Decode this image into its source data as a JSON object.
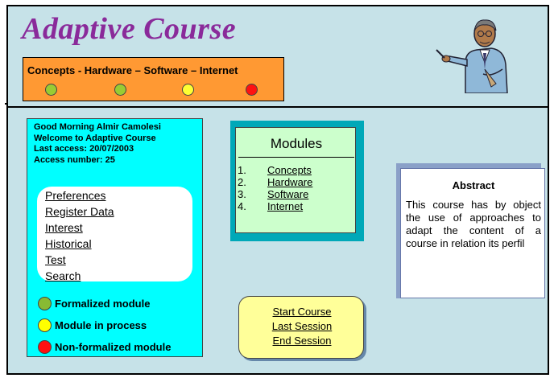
{
  "app": {
    "title": "Adaptive Course"
  },
  "topics": {
    "label": "Concepts  - Hardware – Software – Internet",
    "dots": [
      {
        "name": "Concepts",
        "color": "#99cc33"
      },
      {
        "name": "Hardware",
        "color": "#99cc33"
      },
      {
        "name": "Software",
        "color": "#ffff33"
      },
      {
        "name": "Internet",
        "color": "#ff1111"
      }
    ]
  },
  "user": {
    "greeting_prefix": "Good Morning ",
    "name": "Almir Camolesi",
    "welcome": "Welcome to Adaptive Course",
    "last_access": "Last access: 20/07/2003",
    "access_number": "Access number: 25"
  },
  "menu": {
    "items": [
      "Preferences",
      "Register Data",
      "Interest",
      "Historical",
      "Test",
      "Search"
    ]
  },
  "legend": {
    "items": [
      {
        "label": "Formalized module",
        "color": "#88bb33"
      },
      {
        "label": "Module in process",
        "color": "#ffff00"
      },
      {
        "label": "Non-formalized module",
        "color": "#ff1111"
      }
    ]
  },
  "modules": {
    "title": "Modules",
    "items": [
      {
        "num": "1.",
        "label": "Concepts"
      },
      {
        "num": "2.",
        "label": "Hardware"
      },
      {
        "num": "3.",
        "label": "Software"
      },
      {
        "num": "4.",
        "label": "Internet"
      }
    ]
  },
  "abstract": {
    "title": "Abstract",
    "text": "This course has by object the use of approaches to adapt the content of a course in relation its perfil"
  },
  "session": {
    "items": [
      "Start Course",
      "Last Session",
      "End Session"
    ]
  },
  "colors": {
    "accent": "#8a2a9a",
    "panel": "#c6e2e8",
    "topics_bar": "#ff9933"
  },
  "icons": {
    "teacher": "teacher-pointing-clipart"
  }
}
